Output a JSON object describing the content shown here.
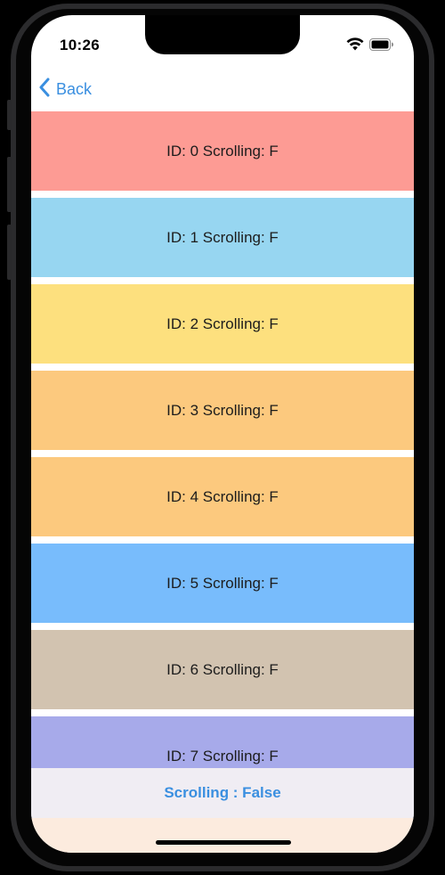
{
  "status_bar": {
    "time": "10:26",
    "icons": [
      "wifi-icon",
      "battery-icon"
    ]
  },
  "nav": {
    "back_label": "Back",
    "accent_color": "#3a8fe0"
  },
  "rows": [
    {
      "label": "ID: 0 Scrolling: F",
      "color": "#fd9b94"
    },
    {
      "label": "ID: 1 Scrolling: F",
      "color": "#97d6f1"
    },
    {
      "label": "ID: 2 Scrolling: F",
      "color": "#fde07e"
    },
    {
      "label": "ID: 3 Scrolling: F",
      "color": "#fcc97e"
    },
    {
      "label": "ID: 4 Scrolling: F",
      "color": "#fcc97e"
    },
    {
      "label": "ID: 5 Scrolling: F",
      "color": "#78bcfc"
    },
    {
      "label": "ID: 6 Scrolling: F",
      "color": "#d2c3b0"
    },
    {
      "label": "ID: 7 Scrolling: F",
      "color": "#a7aaea"
    }
  ],
  "bottom_bar": {
    "label": "Scrolling : False"
  }
}
